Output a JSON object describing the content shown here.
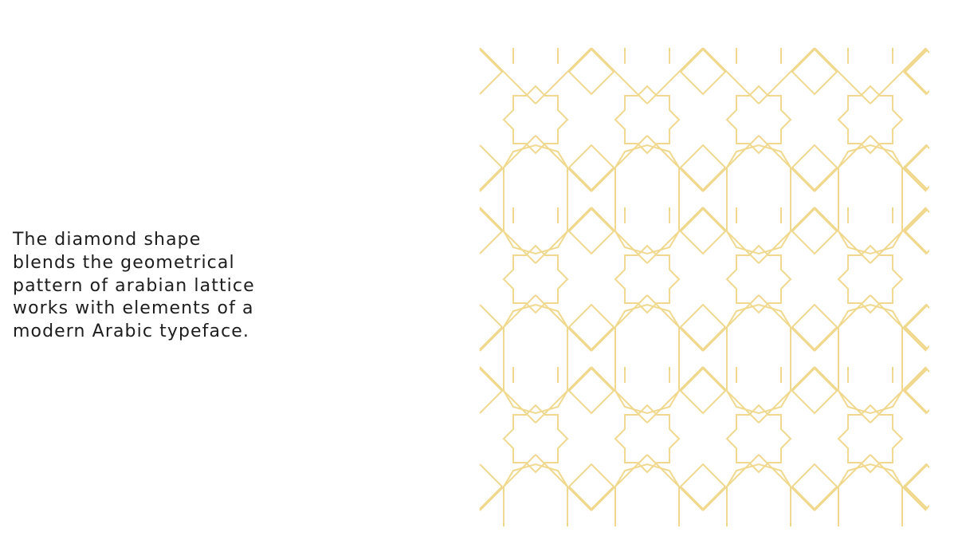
{
  "description": {
    "lines": [
      "The diamond shape",
      "blends the geometrical",
      "pattern of arabian lattice",
      "works with elements of a",
      "modern Arabic typeface."
    ]
  },
  "pattern": {
    "name": "arabian-lattice-pattern",
    "color": "#f0d98f",
    "columns": 4,
    "rows": 3
  }
}
